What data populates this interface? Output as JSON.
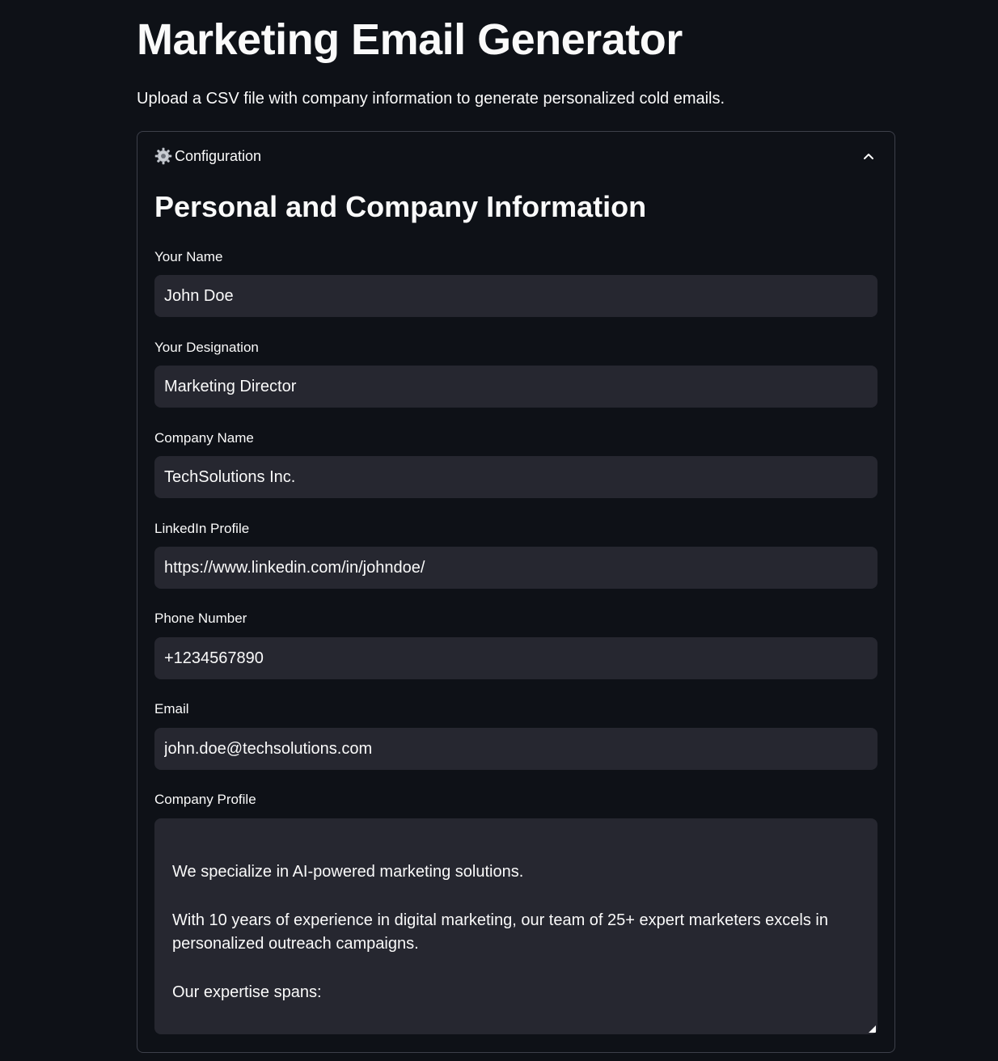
{
  "page": {
    "title": "Marketing Email Generator",
    "subtitle": "Upload a CSV file with company information to generate personalized cold emails."
  },
  "expander": {
    "icon": "gear-icon",
    "label": "Configuration",
    "state_icon": "chevron-up-icon",
    "expanded": true
  },
  "section": {
    "title": "Personal and Company Information"
  },
  "fields": {
    "name": {
      "label": "Your Name",
      "value": "John Doe"
    },
    "designation": {
      "label": "Your Designation",
      "value": "Marketing Director"
    },
    "company": {
      "label": "Company Name",
      "value": "TechSolutions Inc."
    },
    "linkedin": {
      "label": "LinkedIn Profile",
      "value": "https://www.linkedin.com/in/johndoe/"
    },
    "phone": {
      "label": "Phone Number",
      "value": "+1234567890"
    },
    "email": {
      "label": "Email",
      "value": "john.doe@techsolutions.com"
    },
    "profile": {
      "label": "Company Profile",
      "paragraphs": [
        "We specialize in AI-powered marketing solutions.",
        "With 10 years of experience in digital marketing, our team of 25+ expert marketers excels in personalized outreach campaigns.",
        "Our expertise spans:"
      ]
    }
  },
  "colors": {
    "background": "#0e1117",
    "input_background": "#262730",
    "border": "#3d404a",
    "text": "#fafafa"
  }
}
